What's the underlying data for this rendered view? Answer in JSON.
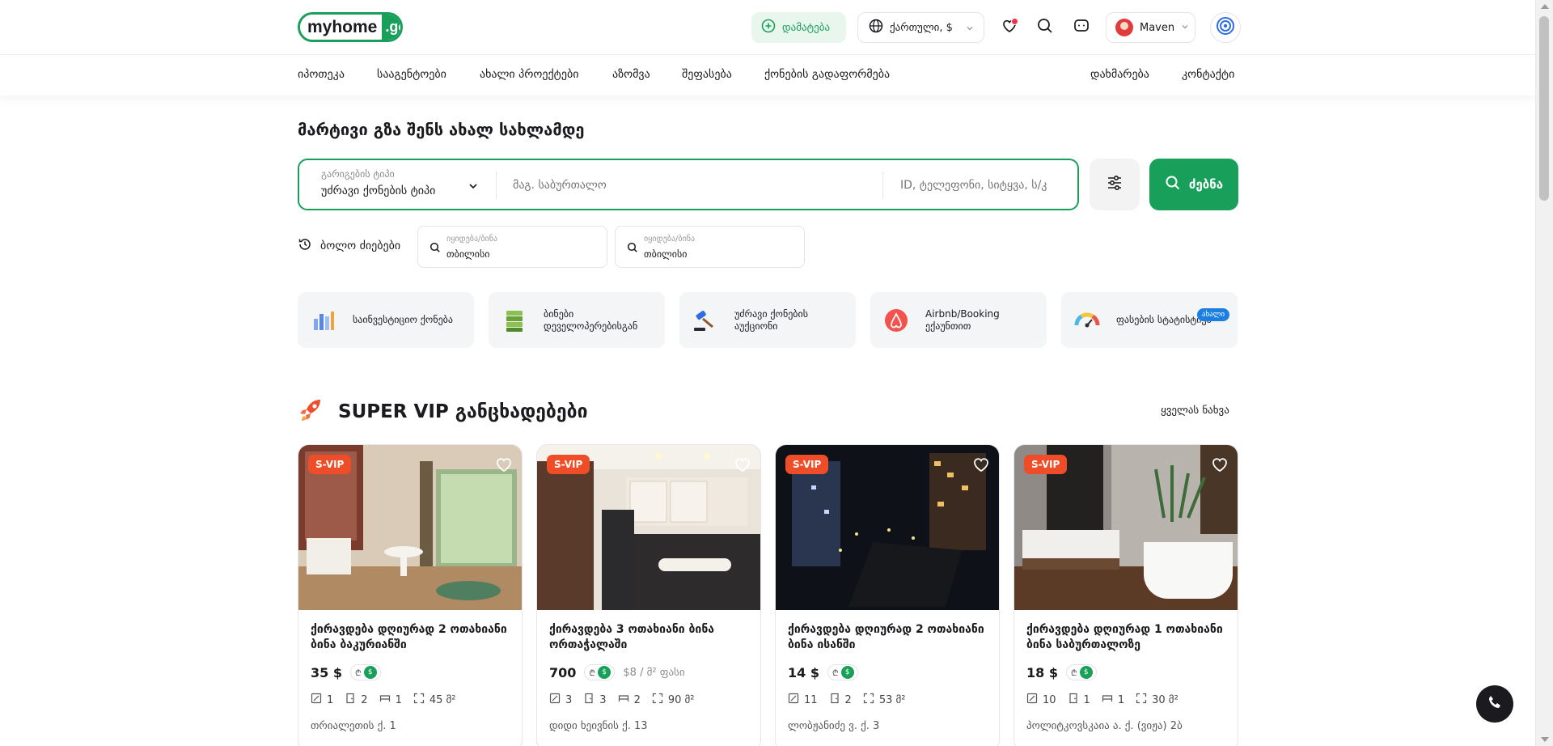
{
  "header": {
    "logo_main": "myhome",
    "logo_ge": ".ge",
    "add_label": "დამატება",
    "lang_label": "ქართული, $",
    "user_name": "Maven"
  },
  "nav": {
    "left": [
      "იპოთეკა",
      "სააგენტოები",
      "ახალი პროექტები",
      "აზომვა",
      "შეფასება",
      "ქონების გადაფორმება"
    ],
    "right": [
      "დახმარება",
      "კონტაქტი"
    ]
  },
  "hero": {
    "title": "მარტივი გზა შენს ახალ სახლამდე",
    "deal_type_label": "გარიგების ტიპი",
    "deal_type_value": "უძრავი ქონების ტიპი",
    "location_placeholder": "მაგ. საბურთალო",
    "id_placeholder": "ID, ტელეფონი, სიტყვა, ს/კ",
    "search_label": "ძებნა"
  },
  "recent": {
    "label": "ბოლო ძიებები",
    "items": [
      {
        "label": "იყიდება/ბინა",
        "value": "თბილისი"
      },
      {
        "label": "იყიდება/ბინა",
        "value": "თბილისი"
      }
    ]
  },
  "categories": [
    {
      "label": "საინვესტიციო ქონება",
      "icon": "bar-chart-icon"
    },
    {
      "label": "ბინები დეველოპერებისგან",
      "icon": "building-stack-icon"
    },
    {
      "label": "უძრავი ქონების აუქციონი",
      "icon": "auction-gavel-icon"
    },
    {
      "label": "Airbnb/Booking ექაუნთით",
      "icon": "airbnb-icon"
    },
    {
      "label": "ფასების სტატისტიკა",
      "icon": "gauge-icon",
      "badge": "ახალი"
    }
  ],
  "vip": {
    "title": "SUPER VIP განცხადებები",
    "see_all": "ყველას ნახვა"
  },
  "listings": [
    {
      "badge": "S-VIP",
      "title": "ქირავდება დღიურად 2 ოთახიანი ბინა ბაკურიანში",
      "price": "35 $",
      "sqm_price": "",
      "rooms": "1",
      "bedrooms": "2",
      "beds": "1",
      "area": "45 მ²",
      "address": "თრიალეთის ქ. 1"
    },
    {
      "badge": "S-VIP",
      "title": "ქირავდება 3 ოთახიანი ბინა ორთაჭალაში",
      "price": "700",
      "sqm_price": "$8 / მ² ფასი",
      "rooms": "3",
      "bedrooms": "3",
      "beds": "2",
      "area": "90 მ²",
      "address": "დიდი ხეივნის ქ. 13"
    },
    {
      "badge": "S-VIP",
      "title": "ქირავდება დღიურად 2 ოთახიანი ბინა ისანში",
      "price": "14 $",
      "sqm_price": "",
      "rooms": "11",
      "bedrooms": "2",
      "beds": "",
      "area": "53 მ²",
      "address": "ლობჟანიძე ვ. ქ. 3"
    },
    {
      "badge": "S-VIP",
      "title": "ქირავდება დღიურად 1 ოთახიანი ბინა საბურთალოზე",
      "price": "18 $",
      "sqm_price": "",
      "rooms": "10",
      "bedrooms": "1",
      "beds": "1",
      "area": "30 მ²",
      "address": "პოლიტკოვსკაია ა. ქ. (ვიჟა) 2ბ"
    }
  ],
  "currency_toggle": {
    "lari": "₾",
    "usd": "$"
  },
  "colors": {
    "brand": "#18a05a",
    "badge": "#ef4d28",
    "accent_blue": "#1a7fe0"
  }
}
